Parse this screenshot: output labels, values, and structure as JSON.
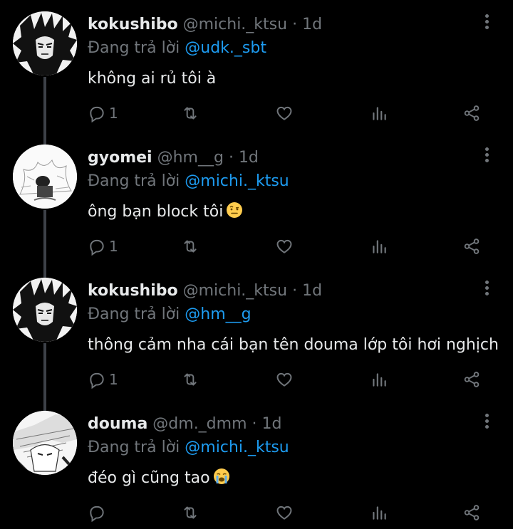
{
  "tweets": [
    {
      "name": "kokushibo",
      "handle": "@michi._ktsu",
      "separator": "·",
      "time": "1d",
      "reply_prefix": "Đang trả lời",
      "reply_to": "@udk._sbt",
      "text": "không ai rủ tôi à",
      "emoji": "",
      "reply_count": "1",
      "avatar": "kokushibo-avatar"
    },
    {
      "name": "gyomei",
      "handle": "@hm__g",
      "separator": "·",
      "time": "1d",
      "reply_prefix": "Đang trả lời",
      "reply_to": "@michi._ktsu",
      "text": "ông bạn block tôi",
      "emoji": "raised-eyebrow-emoji",
      "reply_count": "1",
      "avatar": "gyomei-avatar"
    },
    {
      "name": "kokushibo",
      "handle": "@michi._ktsu",
      "separator": "·",
      "time": "1d",
      "reply_prefix": "Đang trả lời",
      "reply_to": "@hm__g",
      "text": "thông cảm nha cái bạn tên douma lớp tôi hơi nghịch",
      "emoji": "",
      "reply_count": "1",
      "avatar": "kokushibo-avatar"
    },
    {
      "name": "douma",
      "handle": "@dm._dmm",
      "separator": "·",
      "time": "1d",
      "reply_prefix": "Đang trả lời",
      "reply_to": "@michi._ktsu",
      "text": "đéo gì cũng tao",
      "emoji": "loudly-crying-emoji",
      "reply_count": "",
      "avatar": "douma-avatar"
    }
  ],
  "icons": {
    "reply": "reply-icon",
    "retweet": "retweet-icon",
    "like": "heart-icon",
    "views": "views-icon",
    "share": "share-icon",
    "more": "more-vertical-icon"
  },
  "colors": {
    "background": "#000000",
    "text": "#e7e9ea",
    "muted": "#71767b",
    "mention": "#1d9bf0",
    "thread_line": "#3d4148"
  }
}
